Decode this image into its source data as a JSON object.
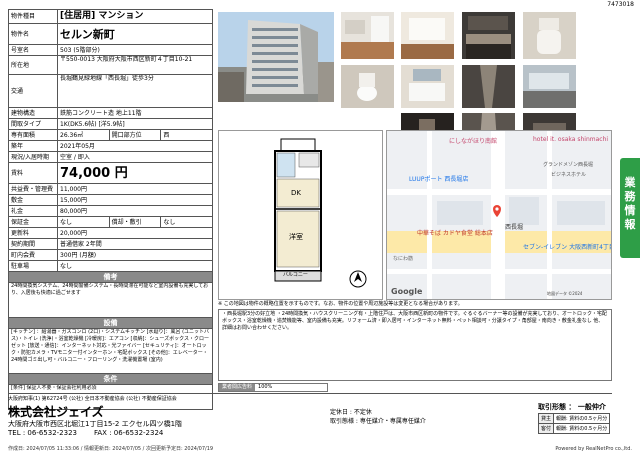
{
  "doc_id": "7473018",
  "info": {
    "rows": [
      {
        "label": "物件種目",
        "value": "[住居用] マンション",
        "style": "h2"
      },
      {
        "label": "物件名",
        "value": "セルン新町",
        "style": "big"
      },
      {
        "label": "号室名",
        "value": "503 (5階部分)"
      },
      {
        "label": "所在地",
        "value": "〒550-0013 大阪府大阪市西区新町４丁目10-21",
        "style": "addr"
      },
      {
        "label": "交通",
        "value": "長堀鶴見緑地線「西長堀」徒歩3分",
        "style": "tall"
      },
      {
        "label": "建物構造",
        "value": "鉄筋コンクリート造 地上11階"
      },
      {
        "label": "間取タイプ",
        "value": "1K(DK5.6帖) [洋5.9帖]"
      },
      {
        "label": "専有面積",
        "value": "26.36㎡",
        "extra_label": "開口部方位",
        "extra_value": "西"
      },
      {
        "label": "築年",
        "value": "2021年05月"
      },
      {
        "label": "現況/入居時期",
        "value": "空室 / 即入"
      }
    ],
    "rent_label": "賃料",
    "rent_value": "74,000 円",
    "fees": [
      {
        "label": "共益費・管理費",
        "value": "11,000円"
      },
      {
        "label": "敷金",
        "value": "15,000円"
      },
      {
        "label": "礼金",
        "value": "80,000円"
      },
      {
        "label": "保証金",
        "value": "なし",
        "extra_label": "償却・敷引",
        "extra_value": "なし"
      },
      {
        "label": "更新料",
        "value": "20,000円"
      },
      {
        "label": "契約期間",
        "value": "普通借家 2年間"
      },
      {
        "label": "町内会費",
        "value": "300円 (月額)"
      },
      {
        "label": "駐車場",
        "value": "なし"
      }
    ],
    "remarks_head": "備考",
    "remarks_text": "24時間換気システム、24時間警備システム・長時間滞在可能など室内設備も充実しており、入居後も快適に過ごせます",
    "facilities_head": "設備",
    "facilities_text": "[キッチン] ：給湯器・ガスコンロ (2口)・システムキッチン [水廻り]：風呂 (ユニットバス)・トイレ (洗浄)・浴室乾燥機 [冷暖房]：エアコン [収納]：シューズボックス・クローゼット [放送・通信]：インターネット対応・光ファイバー [セキュリティ]：オートロック・防犯カメラ・TVモニター付インターホン・宅配ボックス [その他]：エレベーター・24時間ゴミ出し可・バルコニー・フローリング・洗濯機置場 (室内)",
    "terms_head": "条件",
    "terms_text": "[条件] 保証人不要・保証会社利用必須"
  },
  "floorplan": {
    "labels": [
      "DK",
      "洋室",
      "バルコニー"
    ],
    "scale_note": "N"
  },
  "map": {
    "labels": [
      {
        "text": "にしながほり南館",
        "kind": "place"
      },
      {
        "text": "hotel it. osaka shinmachi",
        "kind": "place"
      },
      {
        "text": "LUUPポート 西長堀店",
        "kind": "place"
      },
      {
        "text": "セブン-イレブン 大阪西新町4丁目店",
        "kind": "place"
      },
      {
        "text": "中華そば カドヤ食堂 総本店",
        "kind": "place"
      },
      {
        "text": "西長堀",
        "kind": "station"
      },
      {
        "text": "なにわ筋",
        "kind": "road"
      },
      {
        "text": "ビジネスホテル",
        "kind": "place"
      },
      {
        "text": "グランドメゾン西長堀",
        "kind": "place"
      },
      {
        "text": "Google",
        "kind": "logo"
      },
      {
        "text": "地図データ ©2024",
        "kind": "credit"
      }
    ],
    "note": "※ この地図は物件の概略位置を示すものです。なお、物件の位置や周辺施設等は変更となる場合があります。"
  },
  "features": {
    "text": "・西長堀駅3分の好立地 ・24時間換気・ハウスクリーニング有・上階住戸は、大阪市西区新町の物件です。ぐるぐるバーナー等の設備が充実しており、オートロック・宅配ボックス・浴室乾燥機・追焚機能等、室内設備も充実。リフォーム済・即入居可・インターネット無料・ペット相談可・分譲タイプ・角部屋・南向き・敷金礼金なし 他、詳細はお問い合わせください。"
  },
  "ad_bar": {
    "label": "業者間広告料",
    "value": "100%"
  },
  "agency": {
    "license": "大阪府知事(1) 第62724号 (公社) 全日本不動産協会 (公社) 不動産保証協会",
    "name": "株式会社ジェイズ",
    "address": "大阪府大阪市西区北堀江1丁目15-2 エクセル四ツ橋1階",
    "tel": "TEL : 06-6532-2323",
    "fax": "FAX : 06-6532-2324",
    "contract_label": "定休日 : 不定休",
    "contract_text": "取引態様 : 専任媒介・専属専任媒介"
  },
  "trade": {
    "title": "取引形態 ： 一般仲介",
    "rows": [
      {
        "label": "貸主",
        "value": "報酬: 賃料の0.5ヶ月分"
      },
      {
        "label": "客付",
        "value": "報酬: 賃料の0.5ヶ月分"
      }
    ]
  },
  "footer": {
    "left": "作成日: 2024/07/05 11:33:06 / 情報更新日: 2024/07/05 / 次回更新予定日: 2024/07/19",
    "right": "Powered by RealNetPro co.,ltd."
  },
  "sidetab": [
    "業",
    "務",
    "情",
    "報"
  ],
  "colors": {
    "accent_green": "#2e9e47",
    "section_gray": "#8a8a8a"
  }
}
